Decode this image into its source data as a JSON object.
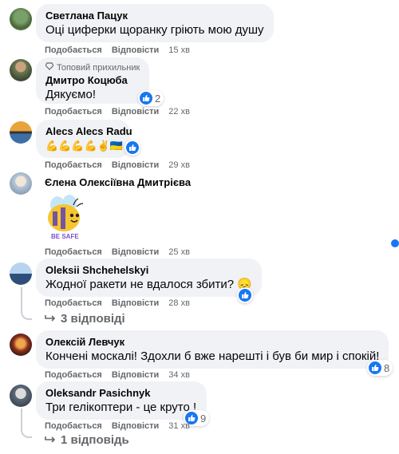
{
  "actions": {
    "like": "Подобається",
    "reply": "Відповісти"
  },
  "comments": [
    {
      "author": "Светлана Пацук",
      "text": "Оці циферки щоранку гріють мою душу",
      "time": "15 хв"
    },
    {
      "badge": "Топовий прихильник",
      "badge_icon": "diamond-icon",
      "author": "Дмитро Коцюба",
      "text": "Дякуємо!",
      "time": "22 хв",
      "reactions": "2"
    },
    {
      "author": "Alecs Alecs Radu",
      "text": "💪💪💪💪✌🇺🇦",
      "time": "29 хв"
    },
    {
      "author": "Єлена Олексіївна Дмитрієва",
      "sticker_text": "BE SAFE",
      "time": "25 хв"
    },
    {
      "author": "Oleksii Shchehelskyi",
      "text": "Жодної ракети не вдалося збити? 😞",
      "time": "28 хв",
      "replies": "3 відповіді"
    },
    {
      "author": "Олексій Левчук",
      "text": "Кончені москалі! Здохли б вже нарешті і був би мир і спокій!",
      "time": "34 хв",
      "reactions": "8"
    },
    {
      "author": "Oleksandr Pasichnyk",
      "text": "Три гелікоптери - це круто !",
      "time": "31 хв",
      "reactions": "9",
      "replies": "1 відповідь"
    }
  ],
  "colors": {
    "accent": "#1877f2",
    "bubble": "#f0f2f5",
    "muted": "#65676b"
  }
}
